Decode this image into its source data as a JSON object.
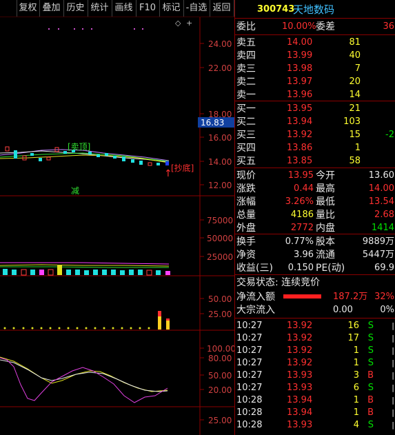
{
  "toolbar": {
    "items": [
      "复权",
      "叠加",
      "历史",
      "统计",
      "画线",
      "F10",
      "标记",
      "-自选",
      "返回"
    ]
  },
  "stock": {
    "code": "300743",
    "name": "天地数码"
  },
  "weibi": {
    "label": "委比",
    "value": "10.00%",
    "diff_label": "委差",
    "diff": "36"
  },
  "asks": [
    {
      "label": "卖五",
      "price": "14.00",
      "vol": "81"
    },
    {
      "label": "卖四",
      "price": "13.99",
      "vol": "40"
    },
    {
      "label": "卖三",
      "price": "13.98",
      "vol": "7"
    },
    {
      "label": "卖二",
      "price": "13.97",
      "vol": "20"
    },
    {
      "label": "卖一",
      "price": "13.96",
      "vol": "14"
    }
  ],
  "bids": [
    {
      "label": "买一",
      "price": "13.95",
      "vol": "21",
      "chg": ""
    },
    {
      "label": "买二",
      "price": "13.94",
      "vol": "103",
      "chg": ""
    },
    {
      "label": "买三",
      "price": "13.92",
      "vol": "15",
      "chg": "-2"
    },
    {
      "label": "买四",
      "price": "13.86",
      "vol": "1",
      "chg": ""
    },
    {
      "label": "买五",
      "price": "13.85",
      "vol": "58",
      "chg": ""
    }
  ],
  "quote": [
    {
      "l1": "现价",
      "v1": "13.95",
      "l2": "今开",
      "v2": "13.60"
    },
    {
      "l1": "涨跌",
      "v1": "0.44",
      "l2": "最高",
      "v2": "14.00"
    },
    {
      "l1": "涨幅",
      "v1": "3.26%",
      "l2": "最低",
      "v2": "13.54"
    },
    {
      "l1": "总量",
      "v1": "4186",
      "l2": "量比",
      "v2": "2.68"
    },
    {
      "l1": "外盘",
      "v1": "2772",
      "l2": "内盘",
      "v2": "1414"
    }
  ],
  "fund": [
    {
      "l1": "换手",
      "v1": "0.77%",
      "l2": "股本",
      "v2": "9889万"
    },
    {
      "l1": "净资",
      "v1": "3.96",
      "l2": "流通",
      "v2": "5447万"
    },
    {
      "l1": "收益(三)",
      "v1": "0.150",
      "l2": "PE(动)",
      "v2": "69.9"
    }
  ],
  "trade_status": "交易状态: 连续竞价",
  "flow": {
    "net_label": "净流入额",
    "net_value": "187.2万",
    "net_pct": "32%",
    "big_label": "大宗流入",
    "big_value": "0.00",
    "big_pct": "0%"
  },
  "ticks": [
    {
      "t": "10:27",
      "p": "13.92",
      "v": "16",
      "s": "S"
    },
    {
      "t": "10:27",
      "p": "13.92",
      "v": "17",
      "s": "S"
    },
    {
      "t": "10:27",
      "p": "13.92",
      "v": "1",
      "s": "S"
    },
    {
      "t": "10:27",
      "p": "13.92",
      "v": "1",
      "s": "S"
    },
    {
      "t": "10:27",
      "p": "13.93",
      "v": "3",
      "s": "B"
    },
    {
      "t": "10:27",
      "p": "13.93",
      "v": "6",
      "s": "S"
    },
    {
      "t": "10:28",
      "p": "13.94",
      "v": "1",
      "s": "B"
    },
    {
      "t": "10:28",
      "p": "13.94",
      "v": "1",
      "s": "B"
    },
    {
      "t": "10:28",
      "p": "13.93",
      "v": "4",
      "s": "S"
    }
  ],
  "chart": {
    "price_ticks": [
      "24.00",
      "22.00",
      "18.00",
      "16.00",
      "14.00",
      "12.00"
    ],
    "current_price_box": "16.83",
    "sell_label": "[卖顶]",
    "buy_label": "[抄底]",
    "reduce_label": "减",
    "vol_ticks": [
      "75000",
      "50000",
      "25000"
    ],
    "p3_ticks": [
      "50.00",
      "25.00"
    ],
    "p4_ticks": [
      "100.00",
      "80.00",
      "50.00",
      "20.00"
    ],
    "p5_ticks": [
      "25.00"
    ]
  }
}
